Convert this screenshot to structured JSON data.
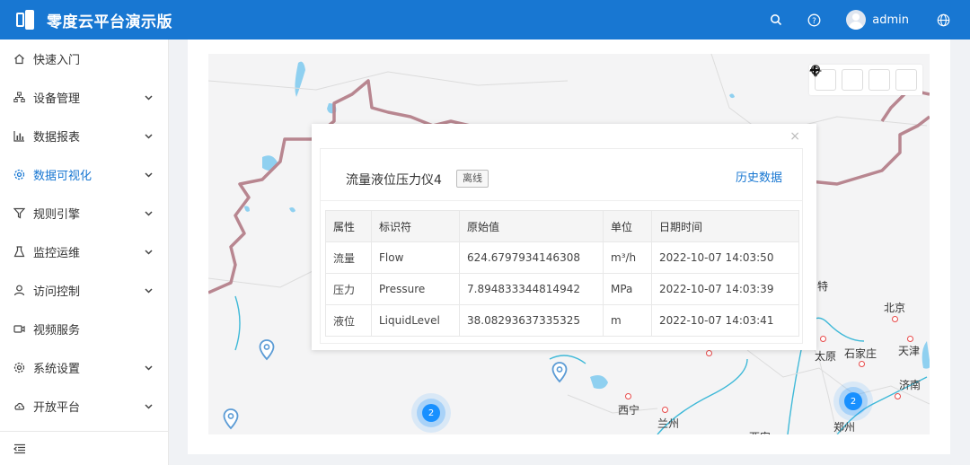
{
  "header": {
    "app_title": "零度云平台演示版",
    "username": "admin",
    "icons": [
      "search-icon",
      "help-icon",
      "avatar",
      "globe-icon"
    ],
    "bg_color": "#1877d2"
  },
  "sidebar": {
    "items": [
      {
        "label": "快速入门",
        "icon": "home-icon",
        "expandable": false,
        "active": false
      },
      {
        "label": "设备管理",
        "icon": "device-tree-icon",
        "expandable": true,
        "active": false
      },
      {
        "label": "数据报表",
        "icon": "bar-chart-icon",
        "expandable": true,
        "active": false
      },
      {
        "label": "数据可视化",
        "icon": "gear-icon",
        "expandable": true,
        "active": true
      },
      {
        "label": "规则引擎",
        "icon": "filter-icon",
        "expandable": true,
        "active": false
      },
      {
        "label": "监控运维",
        "icon": "flask-icon",
        "expandable": true,
        "active": false
      },
      {
        "label": "访问控制",
        "icon": "user-icon",
        "expandable": true,
        "active": false
      },
      {
        "label": "视频服务",
        "icon": "video-icon",
        "expandable": false,
        "active": false
      },
      {
        "label": "系统设置",
        "icon": "settings-icon",
        "expandable": true,
        "active": false
      },
      {
        "label": "开放平台",
        "icon": "cloud-icon",
        "expandable": true,
        "active": false
      }
    ],
    "collapse_icon": "menu-collapse-icon",
    "active_color": "#1877d2"
  },
  "map": {
    "tools": [
      "bulb-icon",
      "locate-icon",
      "zoom-in-icon",
      "zoom-out-icon"
    ],
    "cities": [
      {
        "name": "北京"
      },
      {
        "name": "天津"
      },
      {
        "name": "太原"
      },
      {
        "name": "石家庄"
      },
      {
        "name": "济南"
      },
      {
        "name": "郑州"
      },
      {
        "name": "西宁"
      },
      {
        "name": "兰州"
      },
      {
        "name": "特"
      },
      {
        "name": "西安"
      }
    ],
    "clusters": [
      {
        "count": "2"
      },
      {
        "count": "2"
      }
    ]
  },
  "popup": {
    "device_name": "流量液位压力仪4",
    "status": "离线",
    "history_link": "历史数据",
    "close_symbol": "×",
    "columns": [
      "属性",
      "标识符",
      "原始值",
      "单位",
      "日期时间"
    ],
    "rows": [
      {
        "attr": "流量",
        "id": "Flow",
        "value": "624.6797934146308",
        "unit": "m³/h",
        "time": "2022-10-07 14:03:50"
      },
      {
        "attr": "压力",
        "id": "Pressure",
        "value": "7.894833344814942",
        "unit": "MPa",
        "time": "2022-10-07 14:03:39"
      },
      {
        "attr": "液位",
        "id": "LiquidLevel",
        "value": "38.08293637335325",
        "unit": "m",
        "time": "2022-10-07 14:03:41"
      }
    ]
  }
}
